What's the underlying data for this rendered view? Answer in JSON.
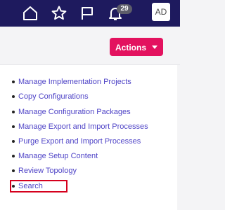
{
  "header": {
    "icons": [
      "home-icon",
      "favorite-star-icon",
      "flag-icon",
      "notifications-bell-icon"
    ],
    "notification_count": "29",
    "user_initials": "AD",
    "background_color": "#1e1a5e"
  },
  "actions": {
    "label": "Actions",
    "color": "#e3125f"
  },
  "tasks": [
    {
      "label": "Manage Implementation Projects"
    },
    {
      "label": "Copy Configurations"
    },
    {
      "label": "Manage Configuration Packages"
    },
    {
      "label": "Manage Export and Import Processes"
    },
    {
      "label": "Purge Export and Import Processes"
    },
    {
      "label": "Manage Setup Content"
    },
    {
      "label": "Review Topology"
    },
    {
      "label": "Search"
    }
  ],
  "colors": {
    "link": "#4f44c7",
    "highlight_box": "#d5001d"
  }
}
